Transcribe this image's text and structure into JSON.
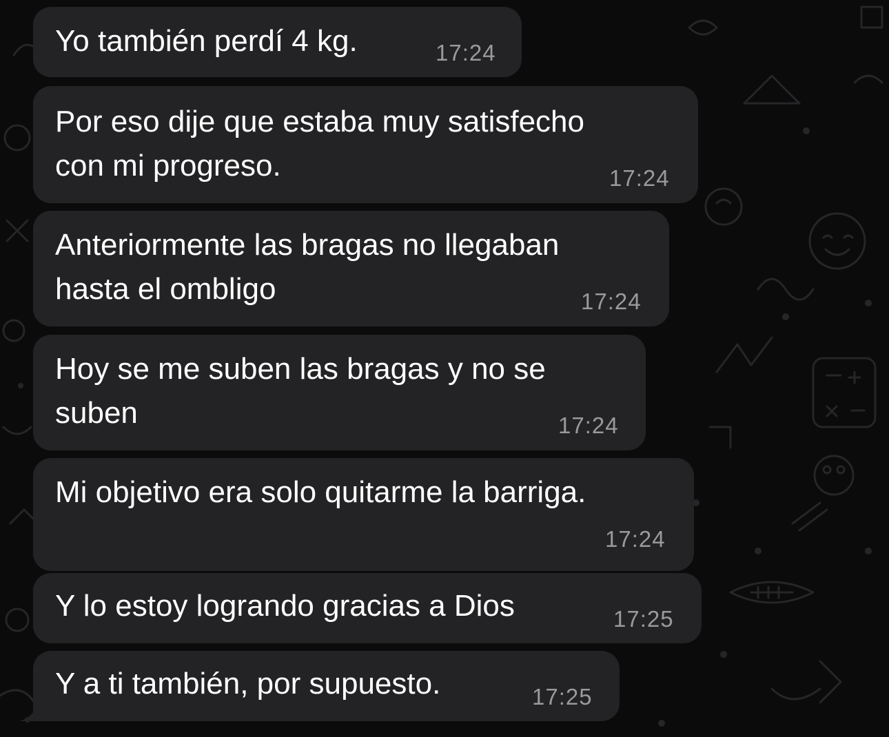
{
  "chat": {
    "messages": [
      {
        "text": "Yo también perdí 4 kg.",
        "time": "17:24"
      },
      {
        "text": "Por eso dije que estaba muy satisfecho\ncon mi progreso.",
        "time": "17:24"
      },
      {
        "text": "Anteriormente las bragas no llegaban\nhasta el ombligo",
        "time": "17:24"
      },
      {
        "text": "Hoy se me suben las bragas y no se\nsuben",
        "time": "17:24"
      },
      {
        "text": "Mi objetivo era solo quitarme la barriga.",
        "time": "17:24"
      },
      {
        "text": "Y lo estoy logrando gracias a Dios",
        "time": "17:25"
      },
      {
        "text": "Y a ti también, por supuesto.",
        "time": "17:25"
      }
    ]
  },
  "colors": {
    "background": "#0b0b0c",
    "bubble": "#232325",
    "text": "#ffffff",
    "time": "#9a9a9c",
    "doodle": "#2a2a2c"
  }
}
